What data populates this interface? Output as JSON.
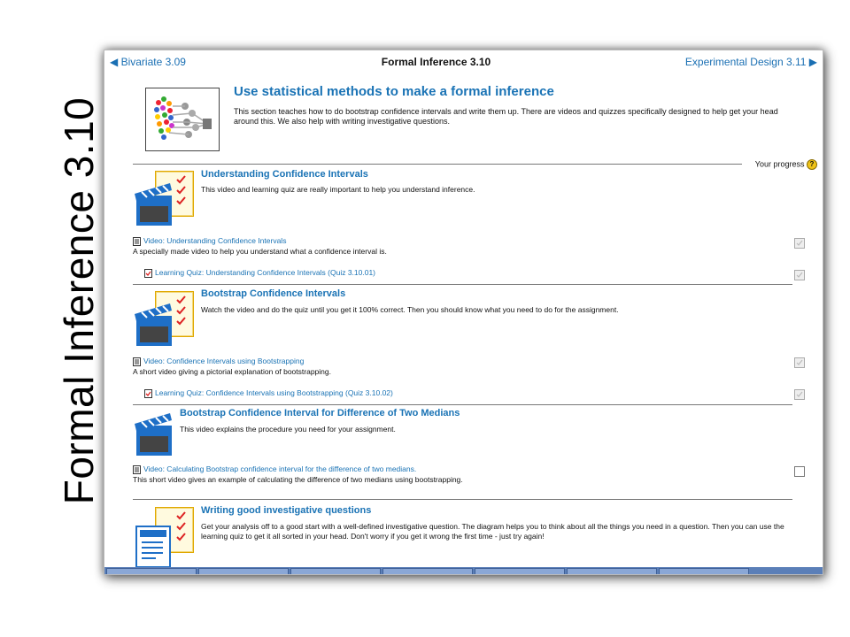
{
  "slide": {
    "title": "Formal Inference 3.10"
  },
  "nav": {
    "prev": "◀ Bivariate 3.09",
    "current": "Formal Inference 3.10",
    "next": "Experimental Design 3.11 ▶"
  },
  "hero": {
    "title": "Use statistical methods to make a formal inference",
    "desc": "This section teaches how to do bootstrap confidence intervals and write them up. There are videos and quizzes specifically designed to help get your head around this. We also help with writing investigative questions."
  },
  "progress_label": "Your progress",
  "progress_help_icon": "?",
  "sections": [
    {
      "title": "Understanding Confidence Intervals",
      "desc": "This video and learning quiz are really important to help you understand inference.",
      "items": [
        {
          "icon": "document-icon",
          "label": "Video: Understanding Confidence Intervals",
          "sub": "A specially made video to help you understand what a confidence interval is.",
          "done": true
        },
        {
          "icon": "quiz-icon",
          "label": "Learning Quiz: Understanding Confidence Intervals (Quiz 3.10.01)",
          "sub": "",
          "done": true
        }
      ]
    },
    {
      "title": "Bootstrap Confidence Intervals",
      "desc": "Watch the video and do the quiz until you get it 100% correct. Then you should know what you need to do for the assignment.",
      "items": [
        {
          "icon": "document-icon",
          "label": "Video: Confidence Intervals using Bootstrapping",
          "sub": "A short video giving a pictorial explanation of bootstrapping.",
          "done": true
        },
        {
          "icon": "quiz-icon",
          "label": "Learning Quiz: Confidence Intervals using Bootstrapping (Quiz 3.10.02)",
          "sub": "",
          "done": true
        }
      ]
    },
    {
      "title": "Bootstrap Confidence Interval for Difference of Two Medians",
      "desc": "This video explains the procedure you need for your assignment.",
      "items": [
        {
          "icon": "document-icon",
          "label": "Video: Calculating Bootstrap confidence interval for the difference of two medians.",
          "sub": "This short video gives an example of calculating the difference of two medians using bootstrapping.",
          "done": false
        }
      ]
    },
    {
      "title": "Writing good investigative questions",
      "desc": "Get your analysis off to a good start with a well-defined investigative question. The diagram helps you to think about all the things you need in a question. Then you can use the learning quiz to get it all sorted in your head. Don't worry if you get it wrong the first time - just try again!",
      "items": []
    }
  ],
  "colors": {
    "link": "#1a73b5",
    "clapper": "#1e6fc7",
    "note": "#f5c518"
  }
}
